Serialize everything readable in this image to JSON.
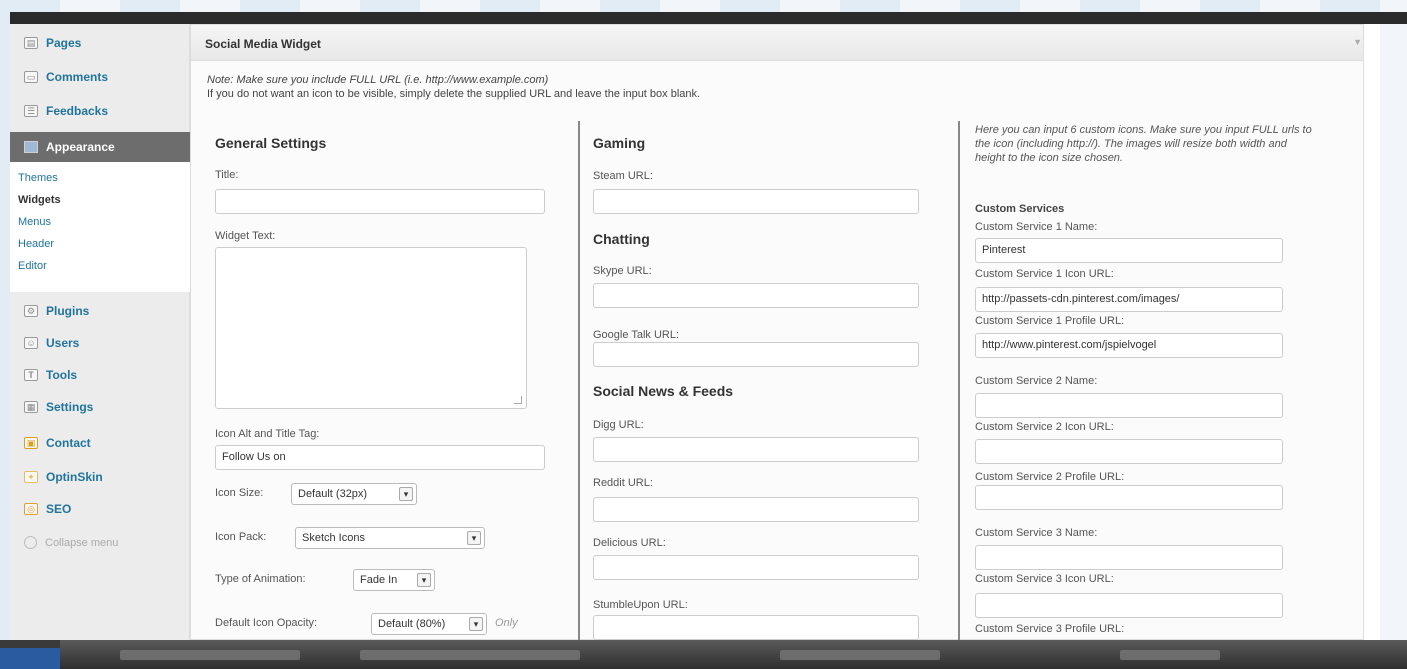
{
  "sidebar": {
    "items": [
      {
        "label": "Pages",
        "icon": "pages-icon"
      },
      {
        "label": "Comments",
        "icon": "comments-icon"
      },
      {
        "label": "Feedbacks",
        "icon": "feedbacks-icon"
      }
    ],
    "active": {
      "label": "Appearance",
      "icon": "appearance-icon"
    },
    "submenu": [
      "Themes",
      "Widgets",
      "Menus",
      "Header",
      "Editor"
    ],
    "current_sub": "Widgets",
    "items_after": [
      {
        "label": "Plugins",
        "icon": "plugins-icon"
      },
      {
        "label": "Users",
        "icon": "users-icon"
      },
      {
        "label": "Tools",
        "icon": "tools-icon"
      },
      {
        "label": "Settings",
        "icon": "settings-icon"
      },
      {
        "label": "Contact",
        "icon": "contact-icon"
      },
      {
        "label": "OptinSkin",
        "icon": "optinskin-icon"
      },
      {
        "label": "SEO",
        "icon": "seo-icon"
      }
    ],
    "collapse_label": "Collapse menu"
  },
  "widget": {
    "title": "Social Media Widget",
    "note_line1": "Note: Make sure you include FULL URL (i.e. http://www.example.com)",
    "note_line2": "If you do not want an icon to be visible, simply delete the supplied URL and leave the input box blank."
  },
  "general": {
    "heading": "General Settings",
    "title_label": "Title:",
    "title_value": "",
    "widget_text_label": "Widget Text:",
    "icon_alt_label": "Icon Alt and Title Tag:",
    "icon_alt_value": "Follow Us on",
    "icon_size_label": "Icon Size:",
    "icon_size_value": "Default (32px)",
    "icon_pack_label": "Icon Pack:",
    "icon_pack_value": "Sketch Icons",
    "animation_label": "Type of Animation:",
    "animation_value": "Fade In",
    "opacity_label": "Default Icon Opacity:",
    "opacity_value": "Default (80%)",
    "only_note": "Only"
  },
  "middle": {
    "gaming_heading": "Gaming",
    "steam_label": "Steam URL:",
    "chatting_heading": "Chatting",
    "skype_label": "Skype URL:",
    "gtalk_label": "Google Talk URL:",
    "news_heading": "Social News & Feeds",
    "digg_label": "Digg URL:",
    "reddit_label": "Reddit URL:",
    "delicious_label": "Delicious URL:",
    "stumble_label": "StumbleUpon URL:"
  },
  "custom": {
    "intro": "Here you can input 6 custom icons. Make sure you input FULL urls to the icon (including http://). The images will resize both width and height to the icon size chosen.",
    "heading": "Custom Services",
    "s1_name_label": "Custom Service 1 Name:",
    "s1_name_value": "Pinterest",
    "s1_icon_label": "Custom Service 1 Icon URL:",
    "s1_icon_value": "http://passets-cdn.pinterest.com/images/",
    "s1_profile_label": "Custom Service 1 Profile URL:",
    "s1_profile_value": "http://www.pinterest.com/jspielvogel",
    "s2_name_label": "Custom Service 2 Name:",
    "s2_icon_label": "Custom Service 2 Icon URL:",
    "s2_profile_label": "Custom Service 2 Profile URL:",
    "s3_name_label": "Custom Service 3 Name:",
    "s3_icon_label": "Custom Service 3 Icon URL:",
    "s3_profile_label": "Custom Service 3 Profile URL:"
  }
}
